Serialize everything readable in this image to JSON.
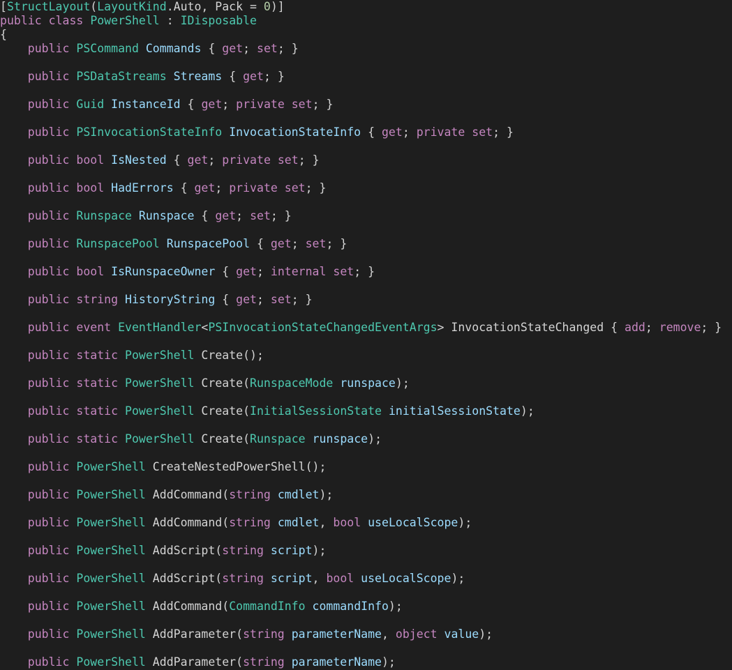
{
  "theme": {
    "background": "#1e1e1e",
    "keyword": "#c586c0",
    "type": "#4ec9b0",
    "identifier": "#9cdcfe",
    "plain": "#d4d4d4",
    "number": "#b5cea8"
  },
  "lines": [
    [
      [
        "p",
        "["
      ],
      [
        "t",
        "StructLayout"
      ],
      [
        "p",
        "("
      ],
      [
        "t",
        "LayoutKind"
      ],
      [
        "p",
        ".Auto, Pack = "
      ],
      [
        "n",
        "0"
      ],
      [
        "p",
        ")]"
      ]
    ],
    [
      [
        "k",
        "public"
      ],
      [
        "p",
        " "
      ],
      [
        "k",
        "class"
      ],
      [
        "p",
        " "
      ],
      [
        "t",
        "PowerShell"
      ],
      [
        "p",
        " : "
      ],
      [
        "t",
        "IDisposable"
      ]
    ],
    [
      [
        "p",
        "{"
      ]
    ],
    [
      [
        "p",
        "    "
      ],
      [
        "k",
        "public"
      ],
      [
        "p",
        " "
      ],
      [
        "t",
        "PSCommand"
      ],
      [
        "p",
        " "
      ],
      [
        "i",
        "Commands"
      ],
      [
        "p",
        " { "
      ],
      [
        "k",
        "get"
      ],
      [
        "p",
        "; "
      ],
      [
        "k",
        "set"
      ],
      [
        "p",
        "; }"
      ]
    ],
    [],
    [
      [
        "p",
        "    "
      ],
      [
        "k",
        "public"
      ],
      [
        "p",
        " "
      ],
      [
        "t",
        "PSDataStreams"
      ],
      [
        "p",
        " "
      ],
      [
        "i",
        "Streams"
      ],
      [
        "p",
        " { "
      ],
      [
        "k",
        "get"
      ],
      [
        "p",
        "; }"
      ]
    ],
    [],
    [
      [
        "p",
        "    "
      ],
      [
        "k",
        "public"
      ],
      [
        "p",
        " "
      ],
      [
        "t",
        "Guid"
      ],
      [
        "p",
        " "
      ],
      [
        "i",
        "InstanceId"
      ],
      [
        "p",
        " { "
      ],
      [
        "k",
        "get"
      ],
      [
        "p",
        "; "
      ],
      [
        "k",
        "private"
      ],
      [
        "p",
        " "
      ],
      [
        "k",
        "set"
      ],
      [
        "p",
        "; }"
      ]
    ],
    [],
    [
      [
        "p",
        "    "
      ],
      [
        "k",
        "public"
      ],
      [
        "p",
        " "
      ],
      [
        "t",
        "PSInvocationStateInfo"
      ],
      [
        "p",
        " "
      ],
      [
        "i",
        "InvocationStateInfo"
      ],
      [
        "p",
        " { "
      ],
      [
        "k",
        "get"
      ],
      [
        "p",
        "; "
      ],
      [
        "k",
        "private"
      ],
      [
        "p",
        " "
      ],
      [
        "k",
        "set"
      ],
      [
        "p",
        "; }"
      ]
    ],
    [],
    [
      [
        "p",
        "    "
      ],
      [
        "k",
        "public"
      ],
      [
        "p",
        " "
      ],
      [
        "k",
        "bool"
      ],
      [
        "p",
        " "
      ],
      [
        "i",
        "IsNested"
      ],
      [
        "p",
        " { "
      ],
      [
        "k",
        "get"
      ],
      [
        "p",
        "; "
      ],
      [
        "k",
        "private"
      ],
      [
        "p",
        " "
      ],
      [
        "k",
        "set"
      ],
      [
        "p",
        "; }"
      ]
    ],
    [],
    [
      [
        "p",
        "    "
      ],
      [
        "k",
        "public"
      ],
      [
        "p",
        " "
      ],
      [
        "k",
        "bool"
      ],
      [
        "p",
        " "
      ],
      [
        "i",
        "HadErrors"
      ],
      [
        "p",
        " { "
      ],
      [
        "k",
        "get"
      ],
      [
        "p",
        "; "
      ],
      [
        "k",
        "private"
      ],
      [
        "p",
        " "
      ],
      [
        "k",
        "set"
      ],
      [
        "p",
        "; }"
      ]
    ],
    [],
    [
      [
        "p",
        "    "
      ],
      [
        "k",
        "public"
      ],
      [
        "p",
        " "
      ],
      [
        "t",
        "Runspace"
      ],
      [
        "p",
        " "
      ],
      [
        "i",
        "Runspace"
      ],
      [
        "p",
        " { "
      ],
      [
        "k",
        "get"
      ],
      [
        "p",
        "; "
      ],
      [
        "k",
        "set"
      ],
      [
        "p",
        "; }"
      ]
    ],
    [],
    [
      [
        "p",
        "    "
      ],
      [
        "k",
        "public"
      ],
      [
        "p",
        " "
      ],
      [
        "t",
        "RunspacePool"
      ],
      [
        "p",
        " "
      ],
      [
        "i",
        "RunspacePool"
      ],
      [
        "p",
        " { "
      ],
      [
        "k",
        "get"
      ],
      [
        "p",
        "; "
      ],
      [
        "k",
        "set"
      ],
      [
        "p",
        "; }"
      ]
    ],
    [],
    [
      [
        "p",
        "    "
      ],
      [
        "k",
        "public"
      ],
      [
        "p",
        " "
      ],
      [
        "k",
        "bool"
      ],
      [
        "p",
        " "
      ],
      [
        "i",
        "IsRunspaceOwner"
      ],
      [
        "p",
        " { "
      ],
      [
        "k",
        "get"
      ],
      [
        "p",
        "; "
      ],
      [
        "k",
        "internal"
      ],
      [
        "p",
        " "
      ],
      [
        "k",
        "set"
      ],
      [
        "p",
        "; }"
      ]
    ],
    [],
    [
      [
        "p",
        "    "
      ],
      [
        "k",
        "public"
      ],
      [
        "p",
        " "
      ],
      [
        "k",
        "string"
      ],
      [
        "p",
        " "
      ],
      [
        "i",
        "HistoryString"
      ],
      [
        "p",
        " { "
      ],
      [
        "k",
        "get"
      ],
      [
        "p",
        "; "
      ],
      [
        "k",
        "set"
      ],
      [
        "p",
        "; }"
      ]
    ],
    [],
    [
      [
        "p",
        "    "
      ],
      [
        "k",
        "public"
      ],
      [
        "p",
        " "
      ],
      [
        "k",
        "event"
      ],
      [
        "p",
        " "
      ],
      [
        "t",
        "EventHandler"
      ],
      [
        "p",
        "<"
      ],
      [
        "t",
        "PSInvocationStateChangedEventArgs"
      ],
      [
        "p",
        "> InvocationStateChanged { "
      ],
      [
        "k",
        "add"
      ],
      [
        "p",
        "; "
      ],
      [
        "k",
        "remove"
      ],
      [
        "p",
        "; }"
      ]
    ],
    [],
    [
      [
        "p",
        "    "
      ],
      [
        "k",
        "public"
      ],
      [
        "p",
        " "
      ],
      [
        "k",
        "static"
      ],
      [
        "p",
        " "
      ],
      [
        "t",
        "PowerShell"
      ],
      [
        "p",
        " Create();"
      ]
    ],
    [],
    [
      [
        "p",
        "    "
      ],
      [
        "k",
        "public"
      ],
      [
        "p",
        " "
      ],
      [
        "k",
        "static"
      ],
      [
        "p",
        " "
      ],
      [
        "t",
        "PowerShell"
      ],
      [
        "p",
        " Create("
      ],
      [
        "t",
        "RunspaceMode"
      ],
      [
        "p",
        " "
      ],
      [
        "i",
        "runspace"
      ],
      [
        "p",
        ");"
      ]
    ],
    [],
    [
      [
        "p",
        "    "
      ],
      [
        "k",
        "public"
      ],
      [
        "p",
        " "
      ],
      [
        "k",
        "static"
      ],
      [
        "p",
        " "
      ],
      [
        "t",
        "PowerShell"
      ],
      [
        "p",
        " Create("
      ],
      [
        "t",
        "InitialSessionState"
      ],
      [
        "p",
        " "
      ],
      [
        "i",
        "initialSessionState"
      ],
      [
        "p",
        ");"
      ]
    ],
    [],
    [
      [
        "p",
        "    "
      ],
      [
        "k",
        "public"
      ],
      [
        "p",
        " "
      ],
      [
        "k",
        "static"
      ],
      [
        "p",
        " "
      ],
      [
        "t",
        "PowerShell"
      ],
      [
        "p",
        " Create("
      ],
      [
        "t",
        "Runspace"
      ],
      [
        "p",
        " "
      ],
      [
        "i",
        "runspace"
      ],
      [
        "p",
        ");"
      ]
    ],
    [],
    [
      [
        "p",
        "    "
      ],
      [
        "k",
        "public"
      ],
      [
        "p",
        " "
      ],
      [
        "t",
        "PowerShell"
      ],
      [
        "p",
        " CreateNestedPowerShell();"
      ]
    ],
    [],
    [
      [
        "p",
        "    "
      ],
      [
        "k",
        "public"
      ],
      [
        "p",
        " "
      ],
      [
        "t",
        "PowerShell"
      ],
      [
        "p",
        " AddCommand("
      ],
      [
        "k",
        "string"
      ],
      [
        "p",
        " "
      ],
      [
        "i",
        "cmdlet"
      ],
      [
        "p",
        ");"
      ]
    ],
    [],
    [
      [
        "p",
        "    "
      ],
      [
        "k",
        "public"
      ],
      [
        "p",
        " "
      ],
      [
        "t",
        "PowerShell"
      ],
      [
        "p",
        " AddCommand("
      ],
      [
        "k",
        "string"
      ],
      [
        "p",
        " "
      ],
      [
        "i",
        "cmdlet"
      ],
      [
        "p",
        ", "
      ],
      [
        "k",
        "bool"
      ],
      [
        "p",
        " "
      ],
      [
        "i",
        "useLocalScope"
      ],
      [
        "p",
        ");"
      ]
    ],
    [],
    [
      [
        "p",
        "    "
      ],
      [
        "k",
        "public"
      ],
      [
        "p",
        " "
      ],
      [
        "t",
        "PowerShell"
      ],
      [
        "p",
        " AddScript("
      ],
      [
        "k",
        "string"
      ],
      [
        "p",
        " "
      ],
      [
        "i",
        "script"
      ],
      [
        "p",
        ");"
      ]
    ],
    [],
    [
      [
        "p",
        "    "
      ],
      [
        "k",
        "public"
      ],
      [
        "p",
        " "
      ],
      [
        "t",
        "PowerShell"
      ],
      [
        "p",
        " AddScript("
      ],
      [
        "k",
        "string"
      ],
      [
        "p",
        " "
      ],
      [
        "i",
        "script"
      ],
      [
        "p",
        ", "
      ],
      [
        "k",
        "bool"
      ],
      [
        "p",
        " "
      ],
      [
        "i",
        "useLocalScope"
      ],
      [
        "p",
        ");"
      ]
    ],
    [],
    [
      [
        "p",
        "    "
      ],
      [
        "k",
        "public"
      ],
      [
        "p",
        " "
      ],
      [
        "t",
        "PowerShell"
      ],
      [
        "p",
        " AddCommand("
      ],
      [
        "t",
        "CommandInfo"
      ],
      [
        "p",
        " "
      ],
      [
        "i",
        "commandInfo"
      ],
      [
        "p",
        ");"
      ]
    ],
    [],
    [
      [
        "p",
        "    "
      ],
      [
        "k",
        "public"
      ],
      [
        "p",
        " "
      ],
      [
        "t",
        "PowerShell"
      ],
      [
        "p",
        " AddParameter("
      ],
      [
        "k",
        "string"
      ],
      [
        "p",
        " "
      ],
      [
        "i",
        "parameterName"
      ],
      [
        "p",
        ", "
      ],
      [
        "k",
        "object"
      ],
      [
        "p",
        " "
      ],
      [
        "i",
        "value"
      ],
      [
        "p",
        ");"
      ]
    ],
    [],
    [
      [
        "p",
        "    "
      ],
      [
        "k",
        "public"
      ],
      [
        "p",
        " "
      ],
      [
        "t",
        "PowerShell"
      ],
      [
        "p",
        " AddParameter("
      ],
      [
        "k",
        "string"
      ],
      [
        "p",
        " "
      ],
      [
        "i",
        "parameterName"
      ],
      [
        "p",
        ");"
      ]
    ]
  ]
}
